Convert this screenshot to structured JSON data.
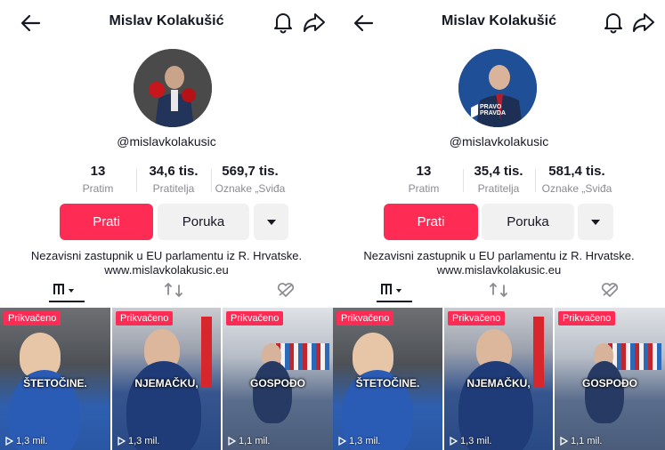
{
  "panels": [
    {
      "profile_name": "Mislav Kolakušić",
      "handle": "@mislavkolakusic",
      "stats": [
        {
          "value": "13",
          "label": "Pratim"
        },
        {
          "value": "34,6 tis.",
          "label": "Pratitelja"
        },
        {
          "value": "569,7 tis.",
          "label": "Oznake „Sviđa"
        }
      ],
      "buttons": {
        "follow": "Prati",
        "message": "Poruka"
      },
      "bio": [
        "Nezavisni zastupnik u EU parlamentu iz R. Hrvatske.",
        "www.mislavkolakusic.eu"
      ],
      "videos": [
        {
          "pinned": "Prikvačeno",
          "caption": "ŠTETOČINE.",
          "views": "1,3 mil."
        },
        {
          "pinned": "Prikvačeno",
          "caption": "NJEMAČKU,",
          "views": "1,3 mil."
        },
        {
          "pinned": "Prikvačeno",
          "caption": "GOSPOĐO",
          "views": "1,1 mil."
        }
      ]
    },
    {
      "profile_name": "Mislav Kolakušić",
      "handle": "@mislavkolakusic",
      "stats": [
        {
          "value": "13",
          "label": "Pratim"
        },
        {
          "value": "35,4 tis.",
          "label": "Pratitelja"
        },
        {
          "value": "581,4 tis.",
          "label": "Oznake „Sviđa"
        }
      ],
      "buttons": {
        "follow": "Prati",
        "message": "Poruka"
      },
      "bio": [
        "Nezavisni zastupnik u EU parlamentu iz R. Hrvatske.",
        "www.mislavkolakusic.eu"
      ],
      "avatar_badge": [
        "PRAVO",
        "PRAVDA"
      ],
      "videos": [
        {
          "pinned": "Prikvačeno",
          "caption": "ŠTETOČINE.",
          "views": "1,3 mil."
        },
        {
          "pinned": "Prikvačeno",
          "caption": "NJEMAČKU,",
          "views": "1,3 mil."
        },
        {
          "pinned": "Prikvačeno",
          "caption": "GOSPOĐO",
          "views": "1,1 mil."
        }
      ]
    }
  ],
  "colors": {
    "accent": "#fe2c55",
    "secondary_button": "#f1f1f2",
    "muted_text": "#8a8b91"
  }
}
